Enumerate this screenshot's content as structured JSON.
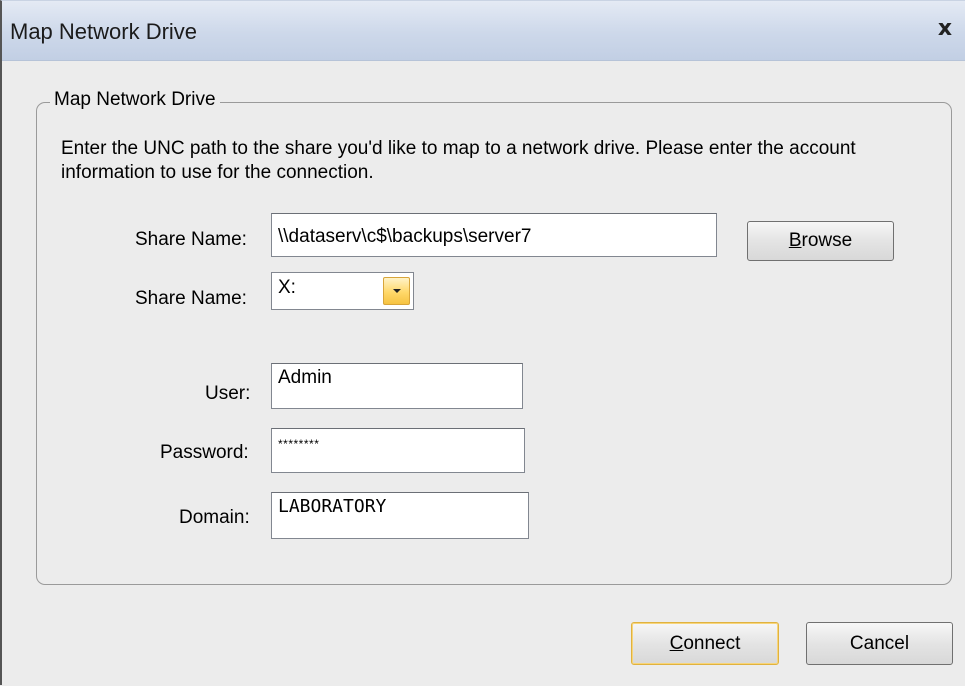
{
  "window": {
    "title": "Map Network Drive",
    "close_glyph": "x"
  },
  "group": {
    "legend": "Map Network Drive",
    "instructions": "Enter the UNC path to the share you'd like to map to a network drive. Please enter the account information to use for the connection."
  },
  "form": {
    "share_label": "Share Name:",
    "share_value": "\\\\dataserv\\c$\\backups\\server7",
    "drive_label": "Share Name:",
    "drive_value": "X:",
    "user_label": "User:",
    "user_value": "Admin",
    "password_label": "Password:",
    "password_value": "********",
    "domain_label": "Domain:",
    "domain_value": "LABORATORY"
  },
  "buttons": {
    "browse_mnemonic": "B",
    "browse_rest": "rowse",
    "connect_mnemonic": "C",
    "connect_rest": "onnect",
    "cancel": "Cancel"
  },
  "colors": {
    "titlebar": "#cdd8ea",
    "dialog_bg": "#ececec",
    "dropdown_accent": "#ffd86a",
    "default_button_border": "#e0b23f"
  }
}
